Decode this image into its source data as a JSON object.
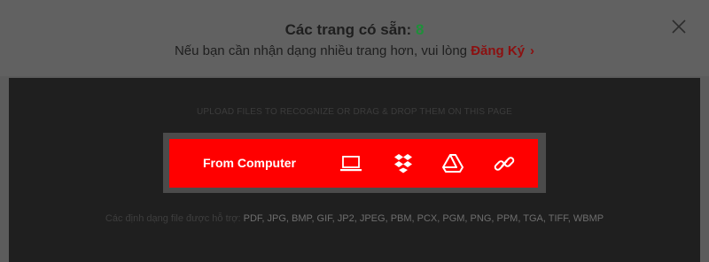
{
  "header": {
    "pages_label": "Các trang có sẵn:",
    "pages_count": "8",
    "register_text": "Nếu bạn cần nhận dạng nhiều trang hơn, vui lòng",
    "register_link": "Đăng Ký",
    "register_chevron": "›"
  },
  "upload": {
    "hint": "UPLOAD FILES TO RECOGNIZE OR DRAG & DROP THEM ON THIS PAGE",
    "from_computer_label": "From Computer",
    "icons": [
      "laptop-icon",
      "dropbox-icon",
      "google-drive-icon",
      "link-icon"
    ]
  },
  "formats": {
    "label": "Các định dạng file được hỗ trợ:",
    "list": "PDF, JPG, BMP, GIF, JP2, JPEG, PBM, PCX, PGM, PNG, PPM, TGA, TIFF, WBMP"
  },
  "colors": {
    "accent": "#ff0000",
    "count": "#1f8f3a",
    "link": "#8c1010",
    "overlay": "#5c5c5c",
    "dark_area": "#1f1f1f"
  }
}
